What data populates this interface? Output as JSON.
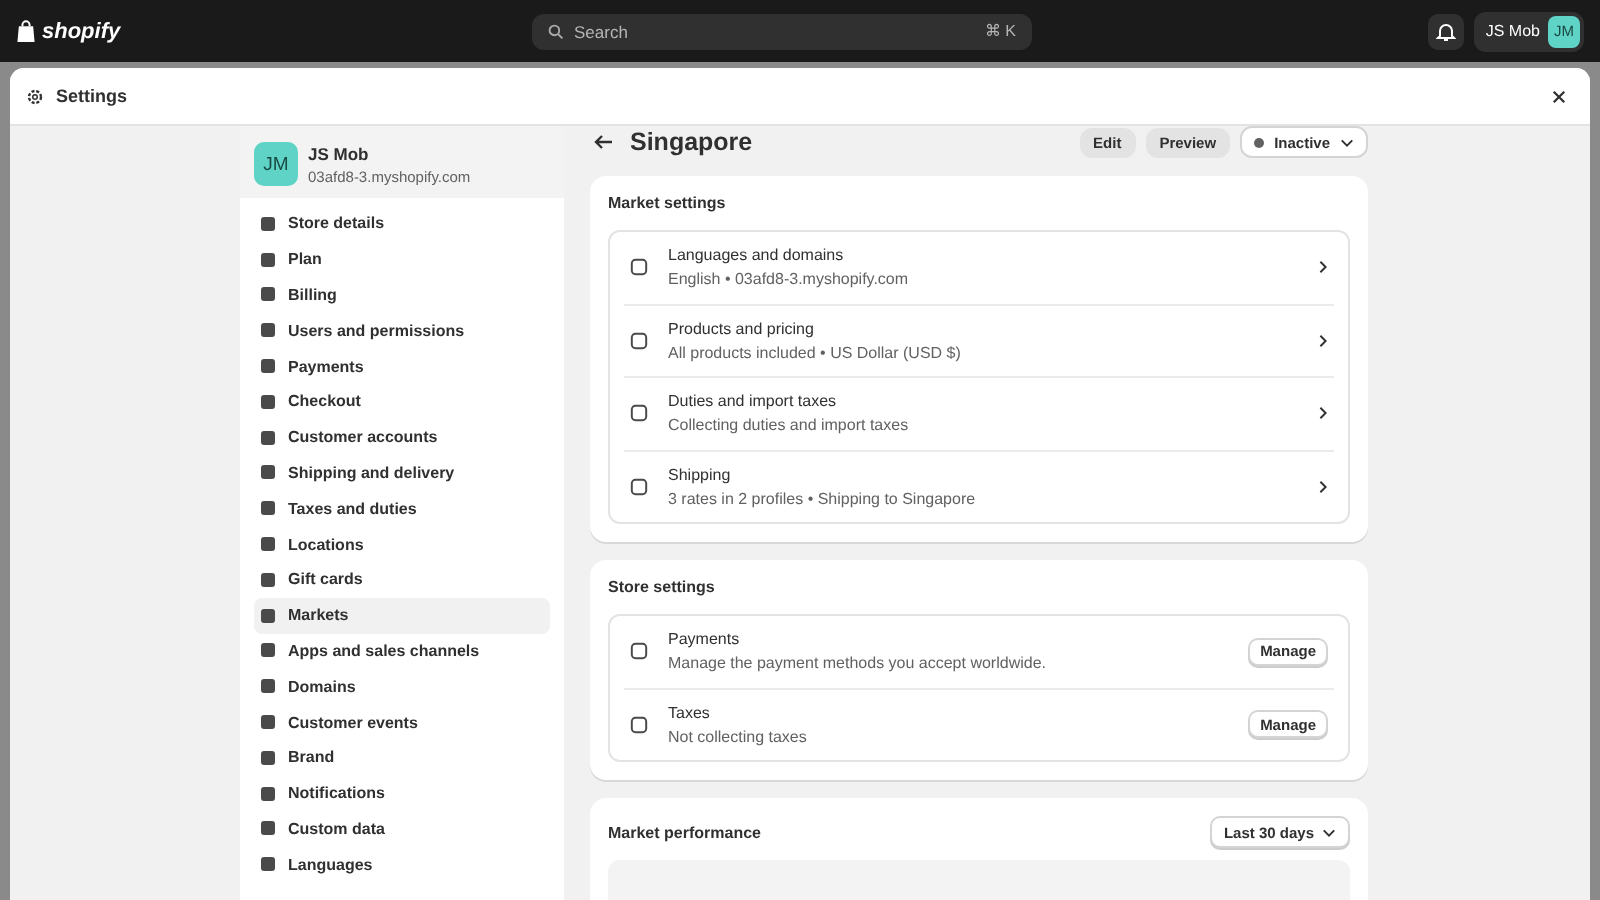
{
  "topbar": {
    "logo": "shopify",
    "search": {
      "placeholder": "Search",
      "shortcut": "⌘ K"
    },
    "account": {
      "name": "JS Mob",
      "initials": "JM"
    }
  },
  "modal": {
    "title": "Settings"
  },
  "store": {
    "initials": "JM",
    "name": "JS Mob",
    "domain": "03afd8-3.myshopify.com"
  },
  "sidebar": {
    "items": [
      {
        "label": "Store details",
        "selected": false
      },
      {
        "label": "Plan",
        "selected": false
      },
      {
        "label": "Billing",
        "selected": false
      },
      {
        "label": "Users and permissions",
        "selected": false
      },
      {
        "label": "Payments",
        "selected": false
      },
      {
        "label": "Checkout",
        "selected": false
      },
      {
        "label": "Customer accounts",
        "selected": false
      },
      {
        "label": "Shipping and delivery",
        "selected": false
      },
      {
        "label": "Taxes and duties",
        "selected": false
      },
      {
        "label": "Locations",
        "selected": false
      },
      {
        "label": "Gift cards",
        "selected": false
      },
      {
        "label": "Markets",
        "selected": true
      },
      {
        "label": "Apps and sales channels",
        "selected": false
      },
      {
        "label": "Domains",
        "selected": false
      },
      {
        "label": "Customer events",
        "selected": false
      },
      {
        "label": "Brand",
        "selected": false
      },
      {
        "label": "Notifications",
        "selected": false
      },
      {
        "label": "Custom data",
        "selected": false
      },
      {
        "label": "Languages",
        "selected": false
      }
    ]
  },
  "page": {
    "title": "Singapore",
    "buttons": [
      "Edit",
      "Preview"
    ],
    "status": "Inactive"
  },
  "market_settings": {
    "title": "Market settings",
    "rows": [
      {
        "title": "Languages and domains",
        "subtitle": "English • 03afd8-3.myshopify.com"
      },
      {
        "title": "Products and pricing",
        "subtitle": "All products included • US Dollar (USD $)"
      },
      {
        "title": "Duties and import taxes",
        "subtitle": "Collecting duties and import taxes"
      },
      {
        "title": "Shipping",
        "subtitle": "3 rates in 2 profiles • Shipping to Singapore"
      }
    ]
  },
  "store_settings": {
    "title": "Store settings",
    "rows": [
      {
        "title": "Payments",
        "subtitle": "Manage the payment methods you accept worldwide.",
        "button": "Manage"
      },
      {
        "title": "Taxes",
        "subtitle": "Not collecting taxes",
        "button": "Manage"
      }
    ]
  },
  "market_performance": {
    "title": "Market performance",
    "range": "Last 30 days"
  }
}
